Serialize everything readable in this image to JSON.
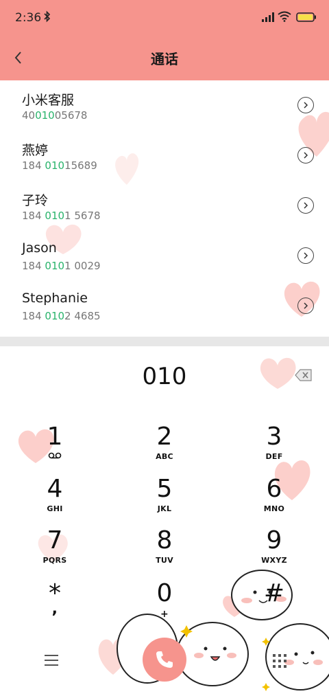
{
  "status": {
    "time": "2:36"
  },
  "header": {
    "title": "通话"
  },
  "contacts": [
    {
      "name": "小米客服",
      "num_pre": "40",
      "num_hl": "010",
      "num_post": "05678"
    },
    {
      "name": "燕婷",
      "num_pre": "184 ",
      "num_hl": "010",
      "num_post": "15689"
    },
    {
      "name": "子玲",
      "num_pre": "184 ",
      "num_hl": "010",
      "num_post": "1 5678"
    },
    {
      "name": "Jason",
      "num_pre": "184 ",
      "num_hl": "010",
      "num_post": "1 0029"
    },
    {
      "name": "Stephanie",
      "num_pre": "184 ",
      "num_hl": "010",
      "num_post": "2 4685"
    }
  ],
  "dialer": {
    "input": "010",
    "keys": [
      {
        "digit": "1",
        "letters": ""
      },
      {
        "digit": "2",
        "letters": "ABC"
      },
      {
        "digit": "3",
        "letters": "DEF"
      },
      {
        "digit": "4",
        "letters": "GHI"
      },
      {
        "digit": "5",
        "letters": "JKL"
      },
      {
        "digit": "6",
        "letters": "MNO"
      },
      {
        "digit": "7",
        "letters": "PQRS"
      },
      {
        "digit": "8",
        "letters": "TUV"
      },
      {
        "digit": "9",
        "letters": "WXYZ"
      },
      {
        "digit": "*",
        "letters": ","
      },
      {
        "digit": "0",
        "letters": "+"
      },
      {
        "digit": "#",
        "letters": ""
      }
    ]
  },
  "colors": {
    "accent": "#f6948d",
    "highlight": "#29b36b",
    "heart": "#fbd3cf"
  },
  "icons": {
    "back": "chevron-left-icon",
    "detail": "chevron-right-circle-icon",
    "backspace": "backspace-icon",
    "voicemail": "voicemail-icon",
    "menu": "menu-icon",
    "call": "phone-icon",
    "keypad": "keypad-icon"
  }
}
